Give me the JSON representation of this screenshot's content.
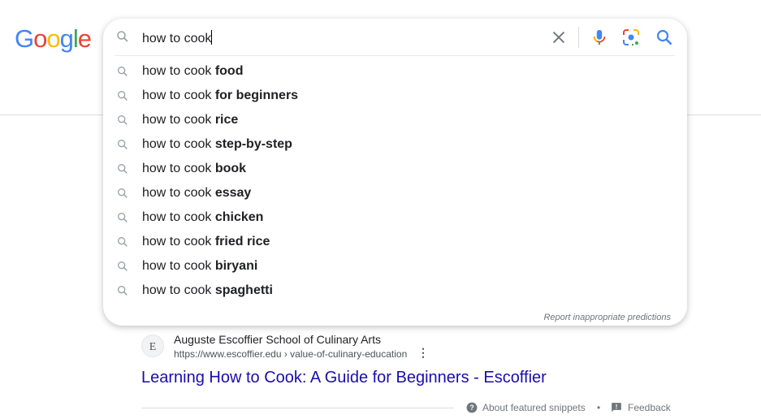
{
  "logo": "Google",
  "search": {
    "query": "how to cook"
  },
  "suggestions": [
    {
      "prefix": "how to cook ",
      "completion": "food"
    },
    {
      "prefix": "how to cook ",
      "completion": "for beginners"
    },
    {
      "prefix": "how to cook ",
      "completion": "rice"
    },
    {
      "prefix": "how to cook ",
      "completion": "step-by-step"
    },
    {
      "prefix": "how to cook ",
      "completion": "book"
    },
    {
      "prefix": "how to cook ",
      "completion": "essay"
    },
    {
      "prefix": "how to cook ",
      "completion": "chicken"
    },
    {
      "prefix": "how to cook ",
      "completion": "fried rice"
    },
    {
      "prefix": "how to cook ",
      "completion": "biryani"
    },
    {
      "prefix": "how to cook ",
      "completion": "spaghetti"
    }
  ],
  "report": "Report inappropriate predictions",
  "result": {
    "favicon": "E",
    "site": "Auguste Escoffier School of Culinary Arts",
    "url": "https://www.escoffier.edu › value-of-culinary-education",
    "title": "Learning How to Cook: A Guide for Beginners - Escoffier"
  },
  "footer": {
    "about": "About featured snippets",
    "sep": "•",
    "feedback": "Feedback"
  },
  "colors": {
    "link": "#1a0dab",
    "blue": "#4285f4",
    "red": "#ea4335",
    "yellow": "#fbbc05",
    "green": "#34a853"
  }
}
